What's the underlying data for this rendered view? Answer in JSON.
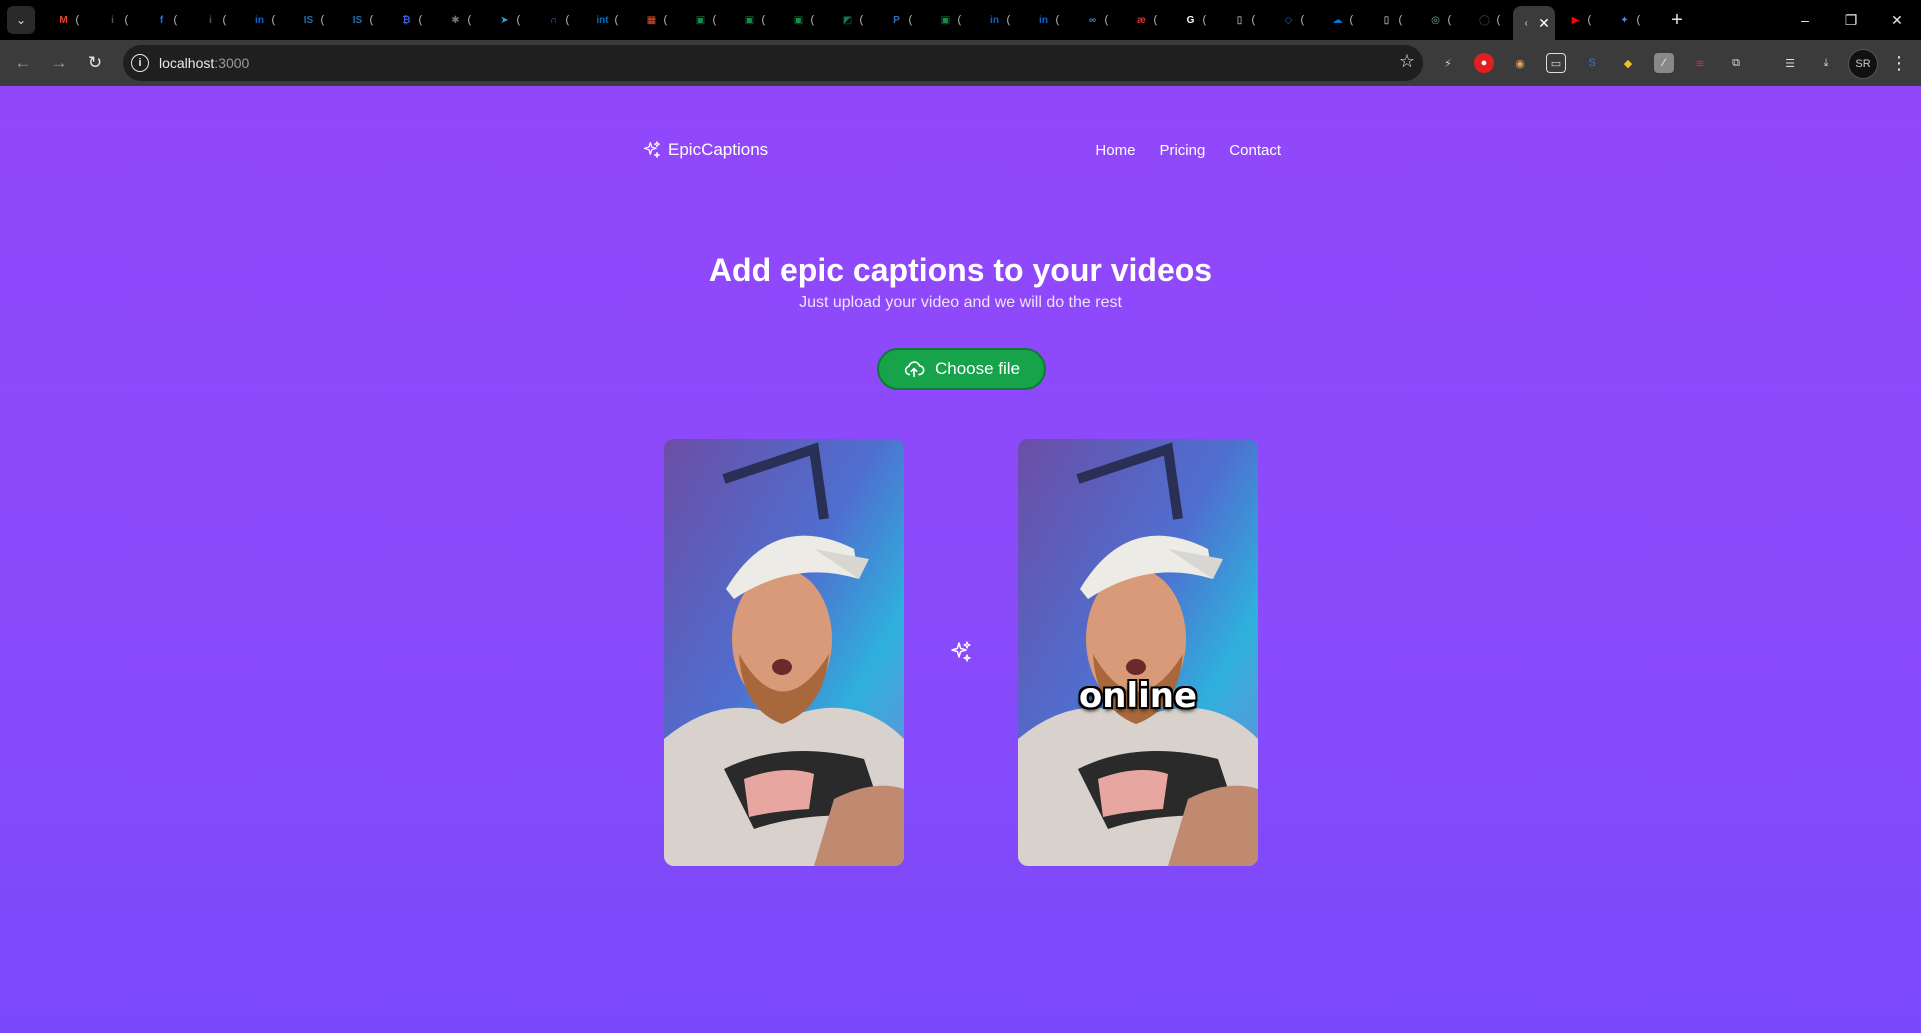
{
  "browser": {
    "url_host": "localhost",
    "url_port": ":3000",
    "tabs": [
      {
        "icon": "gmail-icon",
        "color": "#ea4335",
        "glyph": "M"
      },
      {
        "icon": "info-icon",
        "color": "#555555",
        "glyph": "i"
      },
      {
        "icon": "facebook-icon",
        "color": "#1877f2",
        "glyph": "f"
      },
      {
        "icon": "info-icon",
        "color": "#555555",
        "glyph": "i"
      },
      {
        "icon": "linkedin-icon",
        "color": "#0a66c2",
        "glyph": "in"
      },
      {
        "icon": "is-icon",
        "color": "#1e6fb8",
        "glyph": "IS"
      },
      {
        "icon": "is-icon",
        "color": "#1e6fb8",
        "glyph": "IS"
      },
      {
        "icon": "crypto-icon",
        "color": "#3b5bdb",
        "glyph": "₿"
      },
      {
        "icon": "pinwheel-icon",
        "color": "#777777",
        "glyph": "✱"
      },
      {
        "icon": "telegram-icon",
        "color": "#2aa3e0",
        "glyph": "➤"
      },
      {
        "icon": "headset-icon",
        "color": "#2d6cdf",
        "glyph": "∩"
      },
      {
        "icon": "intel-icon",
        "color": "#0071c5",
        "glyph": "int"
      },
      {
        "icon": "microsoft-icon",
        "color": "#f25022",
        "glyph": "▦"
      },
      {
        "icon": "sheet-icon",
        "color": "#1d8a4a",
        "glyph": "▣"
      },
      {
        "icon": "sheet-icon",
        "color": "#1d8a4a",
        "glyph": "▣"
      },
      {
        "icon": "sheet-icon",
        "color": "#1d8a4a",
        "glyph": "▣"
      },
      {
        "icon": "app-icon",
        "color": "#137a52",
        "glyph": "◩"
      },
      {
        "icon": "p-icon",
        "color": "#2f6fb3",
        "glyph": "P"
      },
      {
        "icon": "sheet-icon",
        "color": "#1d8a4a",
        "glyph": "▣"
      },
      {
        "icon": "linkedin-icon",
        "color": "#0a66c2",
        "glyph": "in"
      },
      {
        "icon": "linkedin-icon",
        "color": "#0a66c2",
        "glyph": "in"
      },
      {
        "icon": "link-icon",
        "color": "#3a8fd8",
        "glyph": "∞"
      },
      {
        "icon": "ae-icon",
        "color": "#cc3333",
        "glyph": "æ"
      },
      {
        "icon": "google-icon",
        "color": "#ffffff",
        "glyph": "G"
      },
      {
        "icon": "doc-icon",
        "color": "#e8e8e8",
        "glyph": "▯"
      },
      {
        "icon": "dropbox-icon",
        "color": "#0061fe",
        "glyph": "◇"
      },
      {
        "icon": "cloud-icon",
        "color": "#0078d4",
        "glyph": "☁"
      },
      {
        "icon": "doc-icon",
        "color": "#e8e8e8",
        "glyph": "▯"
      },
      {
        "icon": "chatgpt-icon",
        "color": "#74aa9c",
        "glyph": "◎"
      },
      {
        "icon": "github-icon",
        "color": "#444444",
        "glyph": "◯"
      }
    ],
    "active_tab_icon": "loading-icon",
    "after_tabs": [
      {
        "icon": "youtube-icon",
        "color": "#ff0000",
        "glyph": "▶"
      },
      {
        "icon": "gemini-icon",
        "color": "#4a86f7",
        "glyph": "✦"
      }
    ],
    "new_tab": "+",
    "window_controls": [
      "–",
      "❐",
      "✕"
    ],
    "profile_initials": "SR"
  },
  "app": {
    "brand": "EpicCaptions",
    "nav": [
      "Home",
      "Pricing",
      "Contact"
    ],
    "headline": "Add epic captions to your videos",
    "subheadline": "Just upload your video and we will do the rest",
    "upload_button": "Choose file",
    "caption_word": "online",
    "accent": "#16a34a",
    "background": "#8a4bfb"
  }
}
